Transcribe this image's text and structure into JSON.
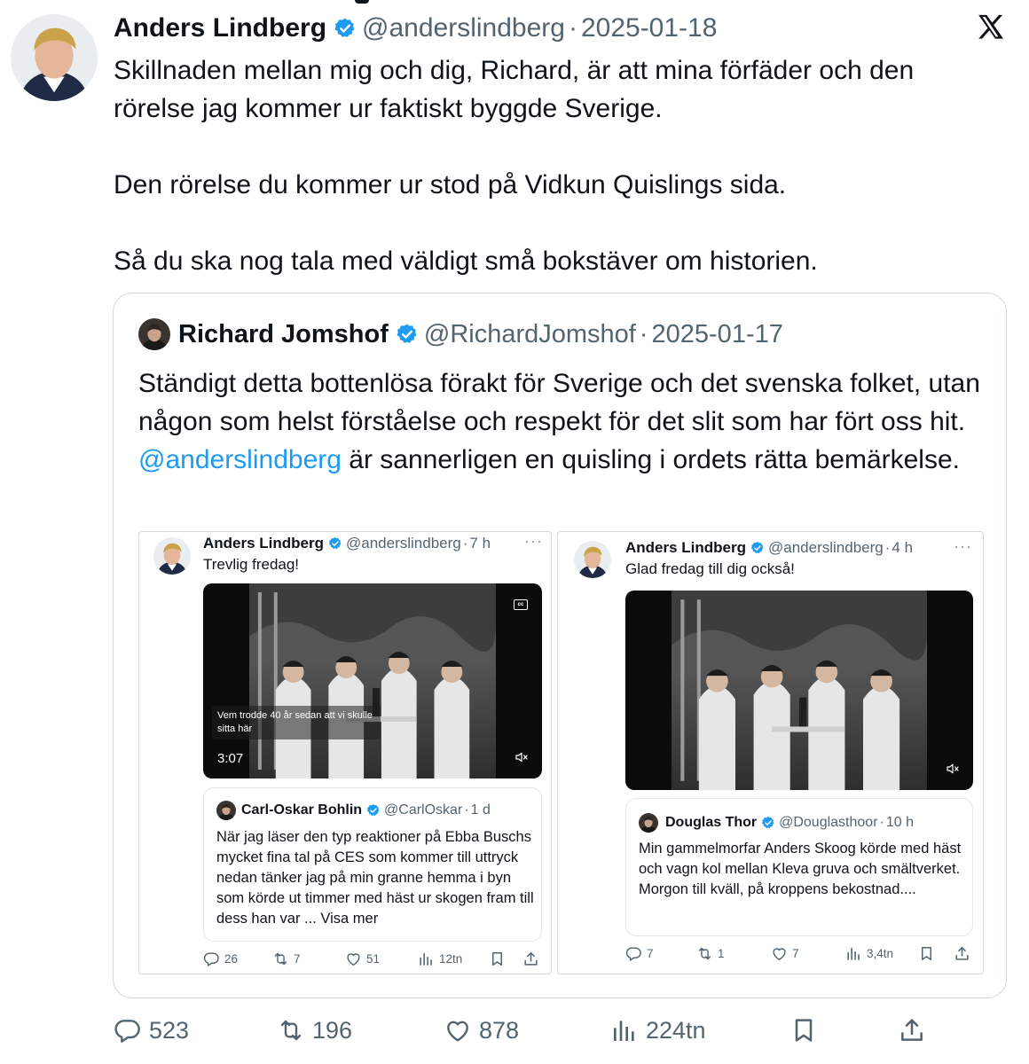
{
  "tweet": {
    "author_name": "Anders Lindberg",
    "handle": "@anderslindberg",
    "separator": "·",
    "date": "2025-01-18",
    "paragraphs": [
      "Skillnaden mellan mig och dig, Richard, är att mina förfäder och den rörelse jag kommer ur faktiskt byggde Sverige.",
      "Den rörelse du kommer ur stod på Vidkun Quislings sida.",
      "Så du ska nog tala med väldigt små bokstäver om historien."
    ],
    "stats": {
      "replies": "523",
      "reposts": "196",
      "likes": "878",
      "views": "224tn"
    }
  },
  "quote": {
    "author_name": "Richard Jomshof",
    "handle": "@RichardJomshof",
    "separator": "·",
    "date": "2025-01-17",
    "text_before": "Ständigt detta bottenlösa förakt för Sverige och det svenska folket, utan någon som helst förståelse och respekt för det slit som har fört oss hit. ",
    "mention": "@anderslindberg",
    "text_after": " är sannerligen en quisling i ordets rätta bemärkelse."
  },
  "embedded": [
    {
      "author_name": "Anders Lindberg",
      "handle": "@anderslindberg",
      "separator": "·",
      "time": "7 h",
      "more": "···",
      "text": "Trevlig fredag!",
      "video": {
        "cc": "cc",
        "subtitle": "Vem trodde 40 år sedan att vi skulle sitta här",
        "duration": "3:07"
      },
      "inner": {
        "author_name": "Carl-Oskar Bohlin",
        "handle": "@CarlOskar",
        "separator": "·",
        "time": "1 d",
        "text": "När jag läser den typ reaktioner på Ebba Buschs mycket fina tal på CES som kommer till uttryck nedan tänker jag på min granne hemma i byn som körde ut timmer med häst ur skogen fram till dess han var ... Visa mer"
      },
      "stats": {
        "replies": "26",
        "reposts": "7",
        "likes": "51",
        "views": "12tn"
      }
    },
    {
      "author_name": "Anders Lindberg",
      "handle": "@anderslindberg",
      "separator": "·",
      "time": "4 h",
      "more": "···",
      "text": "Glad fredag till dig också!",
      "inner": {
        "author_name": "Douglas Thor",
        "handle": "@Douglasthoor",
        "separator": "·",
        "time": "10 h",
        "text": "Min gammelmorfar Anders Skoog körde med häst och vagn kol mellan Kleva gruva och smältverket. Morgon till kväll, på kroppens bekostnad...."
      },
      "stats": {
        "replies": "7",
        "reposts": "1",
        "likes": "7",
        "views": "3,4tn"
      }
    }
  ],
  "colors": {
    "accent": "#1d9bf0",
    "text": "#0f1419",
    "muted": "#536471",
    "border": "#cfd9de"
  }
}
